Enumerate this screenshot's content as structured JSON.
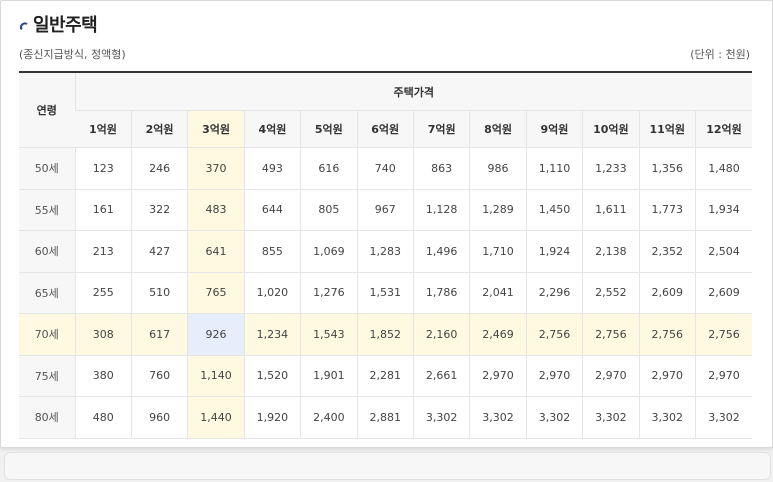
{
  "header": {
    "title": "일반주택",
    "subtitle": "(종신지급방식, 정액형)",
    "unit": "(단위 : 천원)"
  },
  "table": {
    "age_header": "연령",
    "group_header": "주택가격",
    "columns": [
      "1억원",
      "2억원",
      "3억원",
      "4억원",
      "5억원",
      "6억원",
      "7억원",
      "8억원",
      "9억원",
      "10억원",
      "11억원",
      "12억원"
    ],
    "rows": [
      {
        "age": "50세",
        "values": [
          "123",
          "246",
          "370",
          "493",
          "616",
          "740",
          "863",
          "986",
          "1,110",
          "1,233",
          "1,356",
          "1,480"
        ]
      },
      {
        "age": "55세",
        "values": [
          "161",
          "322",
          "483",
          "644",
          "805",
          "967",
          "1,128",
          "1,289",
          "1,450",
          "1,611",
          "1,773",
          "1,934"
        ]
      },
      {
        "age": "60세",
        "values": [
          "213",
          "427",
          "641",
          "855",
          "1,069",
          "1,283",
          "1,496",
          "1,710",
          "1,924",
          "2,138",
          "2,352",
          "2,504"
        ]
      },
      {
        "age": "65세",
        "values": [
          "255",
          "510",
          "765",
          "1,020",
          "1,276",
          "1,531",
          "1,786",
          "2,041",
          "2,296",
          "2,552",
          "2,609",
          "2,609"
        ]
      },
      {
        "age": "70세",
        "values": [
          "308",
          "617",
          "926",
          "1,234",
          "1,543",
          "1,852",
          "2,160",
          "2,469",
          "2,756",
          "2,756",
          "2,756",
          "2,756"
        ]
      },
      {
        "age": "75세",
        "values": [
          "380",
          "760",
          "1,140",
          "1,520",
          "1,901",
          "2,281",
          "2,661",
          "2,970",
          "2,970",
          "2,970",
          "2,970",
          "2,970"
        ]
      },
      {
        "age": "80세",
        "values": [
          "480",
          "960",
          "1,440",
          "1,920",
          "2,400",
          "2,881",
          "3,302",
          "3,302",
          "3,302",
          "3,302",
          "3,302",
          "3,302"
        ]
      }
    ],
    "highlight": {
      "column_index": 2,
      "row_index": 4,
      "colors": {
        "column": "#fef9e0",
        "row": "#fef9e0",
        "cell": "#e6edfb"
      }
    }
  },
  "icons": {
    "title_icon": "circle-arc-icon"
  }
}
